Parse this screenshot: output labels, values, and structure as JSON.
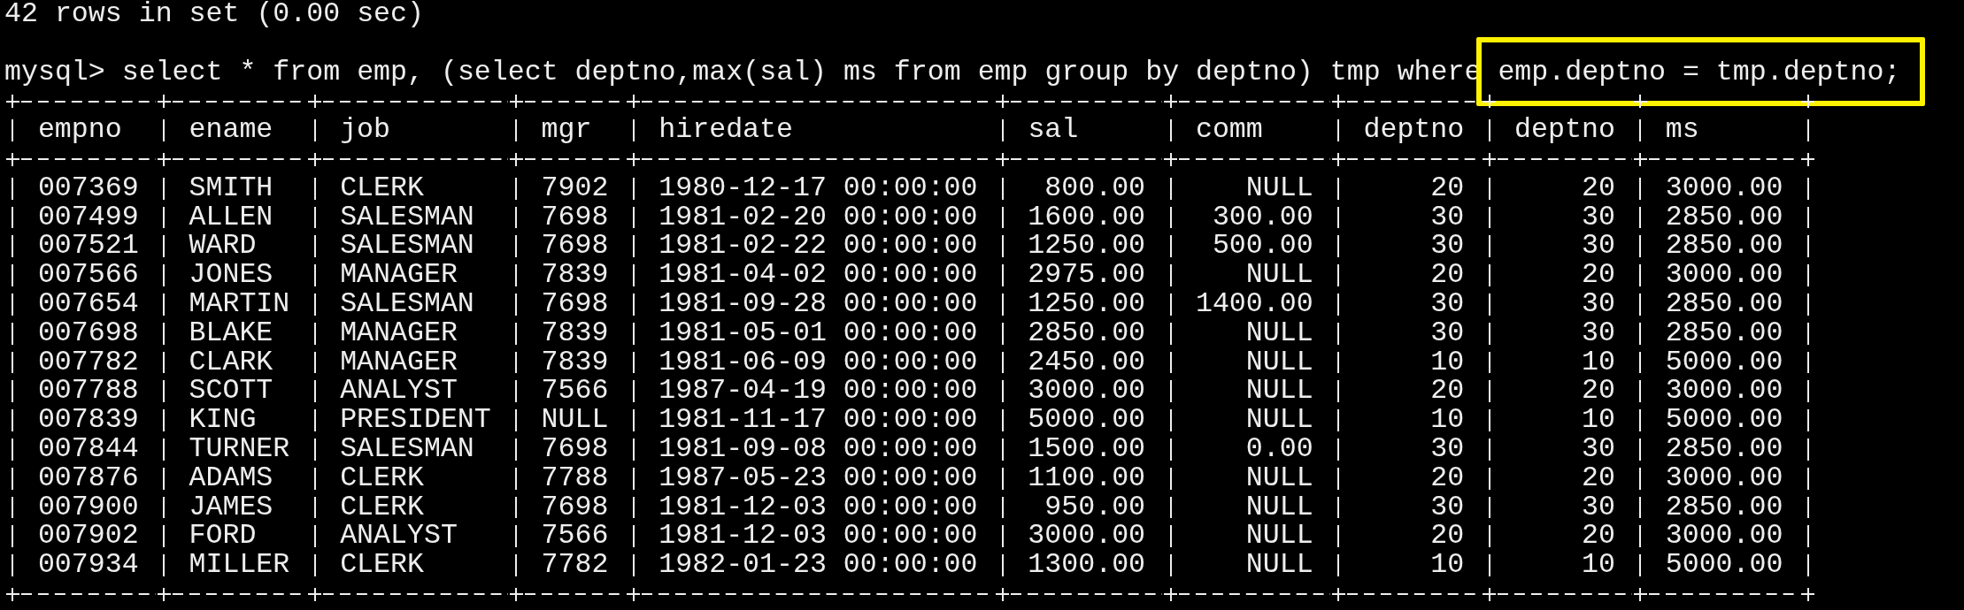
{
  "status_line": "42 rows in set (0.00 sec)",
  "prompt": "mysql>",
  "command": [
    {
      "text": "select * from emp, (select deptno,max(sal) ms from emp group by deptno) tmp where",
      "highlighted": false
    },
    {
      "text": "emp.deptno = tmp.deptno;",
      "highlighted": true
    }
  ],
  "table": {
    "columns": [
      {
        "label": "empno"
      },
      {
        "label": "ename",
        "right_aligned": false
      },
      {
        "label": "job",
        "right_aligned": false
      },
      {
        "label": "mgr"
      },
      {
        "label": "hiredate",
        "right_aligned": false
      },
      {
        "label": "sal",
        "right_aligned": true
      },
      {
        "label": "comm",
        "right_aligned": true
      },
      {
        "label": "deptno",
        "right_aligned": true
      },
      {
        "label": "deptno",
        "right_aligned": true
      },
      {
        "label": "ms",
        "right_aligned": false
      }
    ],
    "rows": [
      [
        "007369",
        "SMITH",
        "CLERK",
        "7902",
        "1980-12-17 00:00:00",
        "800.00",
        "NULL",
        "20",
        "20",
        "3000.00"
      ],
      [
        "007499",
        "ALLEN",
        "SALESMAN",
        "7698",
        "1981-02-20 00:00:00",
        "1600.00",
        "300.00",
        "30",
        "30",
        "2850.00"
      ],
      [
        "007521",
        "WARD",
        "SALESMAN",
        "7698",
        "1981-02-22 00:00:00",
        "1250.00",
        "500.00",
        "30",
        "30",
        "2850.00"
      ],
      [
        "007566",
        "JONES",
        "MANAGER",
        "7839",
        "1981-04-02 00:00:00",
        "2975.00",
        "NULL",
        "20",
        "20",
        "3000.00"
      ],
      [
        "007654",
        "MARTIN",
        "SALESMAN",
        "7698",
        "1981-09-28 00:00:00",
        "1250.00",
        "1400.00",
        "30",
        "30",
        "2850.00"
      ],
      [
        "007698",
        "BLAKE",
        "MANAGER",
        "7839",
        "1981-05-01 00:00:00",
        "2850.00",
        "NULL",
        "30",
        "30",
        "2850.00"
      ],
      [
        "007782",
        "CLARK",
        "MANAGER",
        "7839",
        "1981-06-09 00:00:00",
        "2450.00",
        "NULL",
        "10",
        "10",
        "5000.00"
      ],
      [
        "007788",
        "SCOTT",
        "ANALYST",
        "7566",
        "1987-04-19 00:00:00",
        "3000.00",
        "NULL",
        "20",
        "20",
        "3000.00"
      ],
      [
        "007839",
        "KING",
        "PRESIDENT",
        "NULL",
        "1981-11-17 00:00:00",
        "5000.00",
        "NULL",
        "10",
        "10",
        "5000.00"
      ],
      [
        "007844",
        "TURNER",
        "SALESMAN",
        "7698",
        "1981-09-08 00:00:00",
        "1500.00",
        "0.00",
        "30",
        "30",
        "2850.00"
      ],
      [
        "007876",
        "ADAMS",
        "CLERK",
        "7788",
        "1987-05-23 00:00:00",
        "1100.00",
        "NULL",
        "20",
        "20",
        "3000.00"
      ],
      [
        "007900",
        "JAMES",
        "CLERK",
        "7698",
        "1981-12-03 00:00:00",
        "950.00",
        "NULL",
        "30",
        "30",
        "2850.00"
      ],
      [
        "007902",
        "FORD",
        "ANALYST",
        "7566",
        "1981-12-03 00:00:00",
        "3000.00",
        "NULL",
        "20",
        "20",
        "3000.00"
      ],
      [
        "007934",
        "MILLER",
        "CLERK",
        "7782",
        "1982-01-23 00:00:00",
        "1300.00",
        "NULL",
        "10",
        "10",
        "5000.00"
      ]
    ]
  }
}
